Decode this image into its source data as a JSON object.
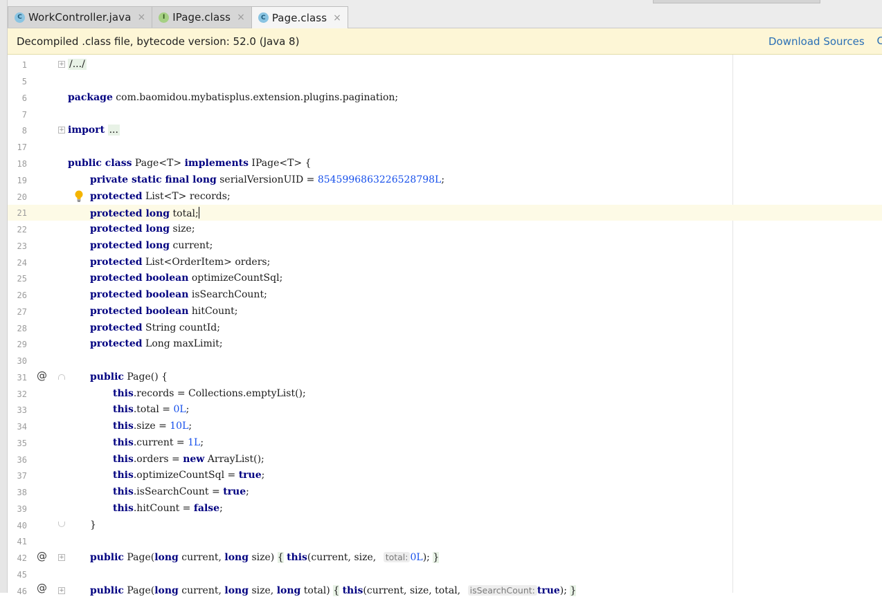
{
  "tabs": [
    {
      "icon": "C",
      "label": "WorkController.java",
      "close": "×"
    },
    {
      "icon": "I",
      "label": "IPage.class",
      "close": "×"
    },
    {
      "icon": "C",
      "label": "Page.class",
      "close": "×"
    }
  ],
  "banner": {
    "message": "Decompiled .class file, bytecode version: 52.0 (Java 8)",
    "download_link": "Download Sources",
    "more": "C"
  },
  "editor": {
    "line_numbers": [
      "1",
      "5",
      "6",
      "7",
      "8",
      "17",
      "18",
      "19",
      "20",
      "21",
      "22",
      "23",
      "24",
      "25",
      "26",
      "27",
      "28",
      "29",
      "30",
      "31",
      "32",
      "33",
      "34",
      "35",
      "36",
      "37",
      "38",
      "39",
      "40",
      "41",
      "42",
      "45",
      "46"
    ],
    "code": {
      "l1": "/.../",
      "l6_kw": "package",
      "l6_rest": " com.baomidou.mybatisplus.extension.plugins.pagination;",
      "l8_kw": "import",
      "l8_fold": "...",
      "l18_kw1": "public class",
      "l18_mid": " Page<T> ",
      "l18_kw2": "implements",
      "l18_rest": " IPage<T> {",
      "l19_kw": "private static final long",
      "l19_mid": " serialVersionUID = ",
      "l19_num": "8545996863226528798L",
      "l19_end": ";",
      "l20_kw": "protected",
      "l20_rest": " List<T> records;",
      "l21_kw": "protected long",
      "l21_rest": " total;",
      "l22_kw": "protected long",
      "l22_rest": " size;",
      "l23_kw": "protected long",
      "l23_rest": " current;",
      "l24_kw": "protected",
      "l24_rest": " List<OrderItem> orders;",
      "l25_kw": "protected boolean",
      "l25_rest": " optimizeCountSql;",
      "l26_kw": "protected boolean",
      "l26_rest": " isSearchCount;",
      "l27_kw": "protected boolean",
      "l27_rest": " hitCount;",
      "l28_kw": "protected",
      "l28_rest": " String countId;",
      "l29_kw": "protected",
      "l29_rest": " Long maxLimit;",
      "l31_kw": "public",
      "l31_rest": " Page() {",
      "l32_kw": "this",
      "l32_rest": ".records = Collections.emptyList();",
      "l33_kw": "this",
      "l33_mid": ".total = ",
      "l33_num": "0L",
      "l33_end": ";",
      "l34_kw": "this",
      "l34_mid": ".size = ",
      "l34_num": "10L",
      "l34_end": ";",
      "l35_kw": "this",
      "l35_mid": ".current = ",
      "l35_num": "1L",
      "l35_end": ";",
      "l36_kw": "this",
      "l36_mid": ".orders = ",
      "l36_kw2": "new",
      "l36_rest": " ArrayList();",
      "l37_kw": "this",
      "l37_mid": ".optimizeCountSql = ",
      "l37_kw2": "true",
      "l37_end": ";",
      "l38_kw": "this",
      "l38_mid": ".isSearchCount = ",
      "l38_kw2": "true",
      "l38_end": ";",
      "l39_kw": "this",
      "l39_mid": ".hitCount = ",
      "l39_kw2": "false",
      "l39_end": ";",
      "l40": "}",
      "l42_kw": "public",
      "l42_a": " Page(",
      "l42_kw2": "long",
      "l42_b": " current, ",
      "l42_kw3": "long",
      "l42_c": " size) ",
      "l42_brace": "{",
      "l42_kw4": "this",
      "l42_d": "(current, size, ",
      "l42_hint": "total:",
      "l42_num": "0L",
      "l42_e": "); ",
      "l42_close": "}",
      "l46_kw": "public",
      "l46_a": " Page(",
      "l46_kw2": "long",
      "l46_b": " current, ",
      "l46_kw3": "long",
      "l46_c": " size, ",
      "l46_kw4": "long",
      "l46_d": " total) ",
      "l46_brace": "{",
      "l46_kw5": "this",
      "l46_e": "(current, size, total, ",
      "l46_hint": "isSearchCount:",
      "l46_kw6": "true",
      "l46_f": "); ",
      "l46_close": "}"
    },
    "at_marker": "@"
  }
}
